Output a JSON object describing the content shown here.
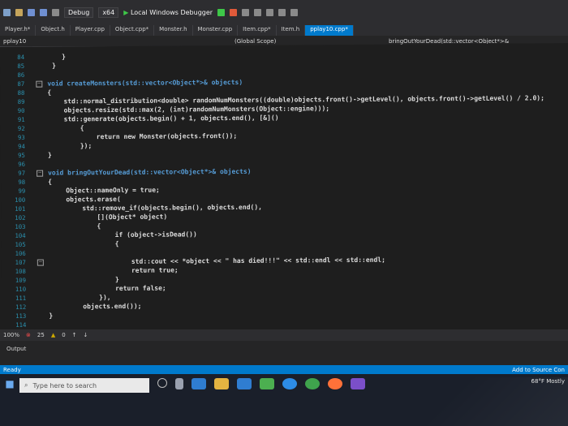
{
  "toolbar": {
    "config": "Debug",
    "platform": "x64",
    "debugger": "Local Windows Debugger"
  },
  "tabs": [
    "Player.h*",
    "Object.h",
    "Player.cpp",
    "Object.cpp*",
    "Monster.h",
    "Monster.cpp",
    "Item.cpp*",
    "Item.h",
    "pplay10.cpp*"
  ],
  "nav": {
    "project": "pplay10",
    "scope": "(Global Scope)",
    "member": "bringOutYourDead(std::vector<Object*>&"
  },
  "editor": {
    "line_numbers": [
      "84",
      "85",
      "86",
      "87",
      "88",
      "89",
      "90",
      "91",
      "92",
      "93",
      "94",
      "95",
      "96",
      "97",
      "98",
      "99",
      "100",
      "101",
      "102",
      "103",
      "104",
      "105",
      "106",
      "107",
      "108",
      "109",
      "110",
      "111",
      "112",
      "113",
      "114"
    ],
    "lines": {
      "l84": "}",
      "l85": "}",
      "l87": "void createMonsters(std::vector<Object*>& objects)",
      "l88": "{",
      "l89": "std::normal_distribution<double> randomNumMonsters((double)objects.front()->getLevel(), objects.front()->getLevel() / 2.0);",
      "l90": "objects.resize(std::max(2, (int)randomNumMonsters(Object::engine)));",
      "l91": "std::generate(objects.begin() + 1, objects.end(), [&]()",
      "l92": "{",
      "l93": "return new Monster(objects.front());",
      "l94": "});",
      "l95": "}",
      "l97": "void bringOutYourDead(std::vector<Object*>& objects)",
      "l98": "{",
      "l99": "Object::nameOnly = true;",
      "l100": "objects.erase(",
      "l101": "std::remove_if(objects.begin(), objects.end(),",
      "l102": "[](Object* object)",
      "l103": "{",
      "l104": "if (object->isDead())",
      "l105": "{",
      "l107": "std::cout << *object << \" has died!!!\" << std::endl << std::endl;",
      "l108": "return true;",
      "l109": "}",
      "l110": "return false;",
      "l111": "}),",
      "l112": "objects.end());",
      "l113": "}"
    }
  },
  "strip": {
    "zoom": "100%",
    "errors": "25",
    "warnings": "0"
  },
  "output": {
    "label": "Output"
  },
  "status": {
    "left": "Ready",
    "right": "Add to Source Con"
  },
  "taskbar": {
    "search_placeholder": "Type here to search",
    "weather": "68°F  Mostly"
  }
}
